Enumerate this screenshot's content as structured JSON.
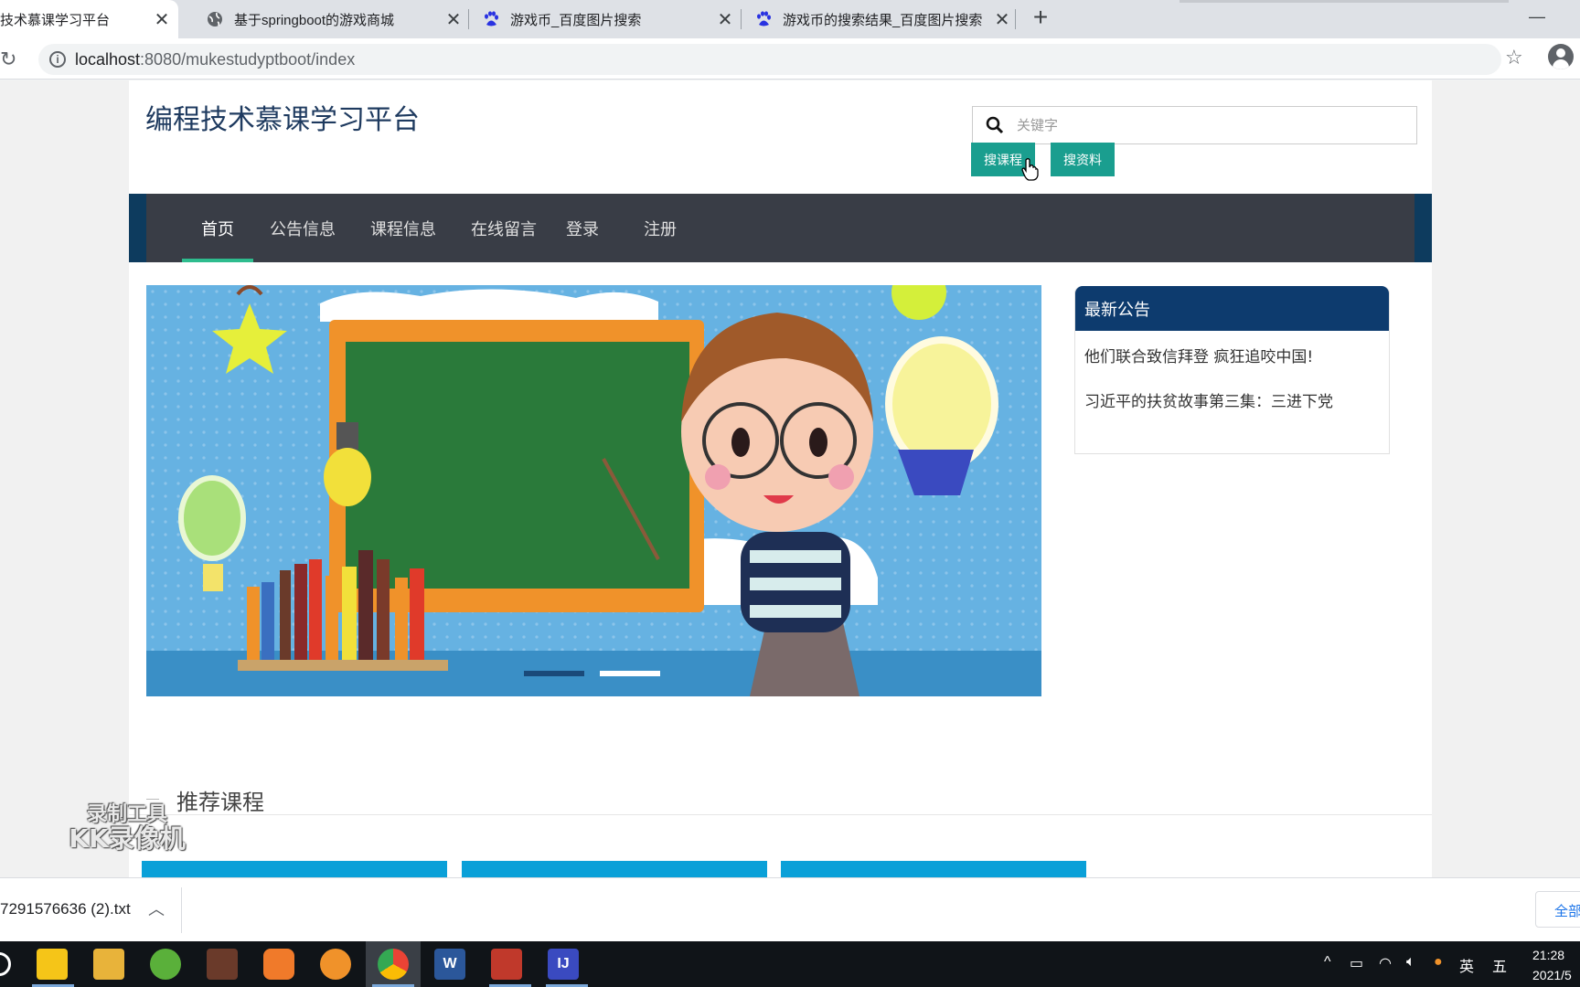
{
  "browser": {
    "tabs": [
      {
        "title": "技术慕课学习平台",
        "icon": "page-icon",
        "active": true
      },
      {
        "title": "基于springboot的游戏商城",
        "icon": "globe-icon",
        "active": false
      },
      {
        "title": "游戏币_百度图片搜索",
        "icon": "baidu-paw-icon",
        "active": false
      },
      {
        "title": "游戏币的搜索结果_百度图片搜索",
        "icon": "baidu-paw-icon",
        "active": false
      }
    ],
    "tab_close_glyph": "✕",
    "new_tab_glyph": "+",
    "address": {
      "host": "localhost",
      "path": ":8080/mukestudyptboot/index"
    }
  },
  "site": {
    "title": "编程技术慕课学习平台",
    "search": {
      "placeholder": "关键字",
      "value": ""
    },
    "buttons": {
      "search_course": "搜课程",
      "search_material": "搜资料"
    },
    "nav": [
      {
        "label": "首页",
        "active": true
      },
      {
        "label": "公告信息",
        "active": false
      },
      {
        "label": "课程信息",
        "active": false
      },
      {
        "label": "在线留言",
        "active": false
      },
      {
        "label": "登录",
        "active": false
      },
      {
        "label": "注册",
        "active": false
      }
    ],
    "notice": {
      "title": "最新公告",
      "items": [
        "他们联合致信拜登 疯狂追咬中国!",
        "习近平的扶贫故事第三集：三进下党"
      ]
    },
    "recommended_title": "推荐课程",
    "carousel": {
      "slides": 2,
      "active_slide": 1
    }
  },
  "watermark": {
    "line1": "录制工具",
    "line2": "KK录像机"
  },
  "downloads": {
    "file": "7291576636 (2).txt",
    "show_all": "全部"
  },
  "taskbar": {
    "ime_lang": "英",
    "ime_mode": "五",
    "time": "21:28",
    "date": "2021/5"
  },
  "colors": {
    "nav_bg": "#393d46",
    "nav_active_underline": "#2ebc8e",
    "teal_button": "#1a9e8f",
    "notice_header": "#0d3b6e",
    "course_card": "#0aa0d8"
  }
}
